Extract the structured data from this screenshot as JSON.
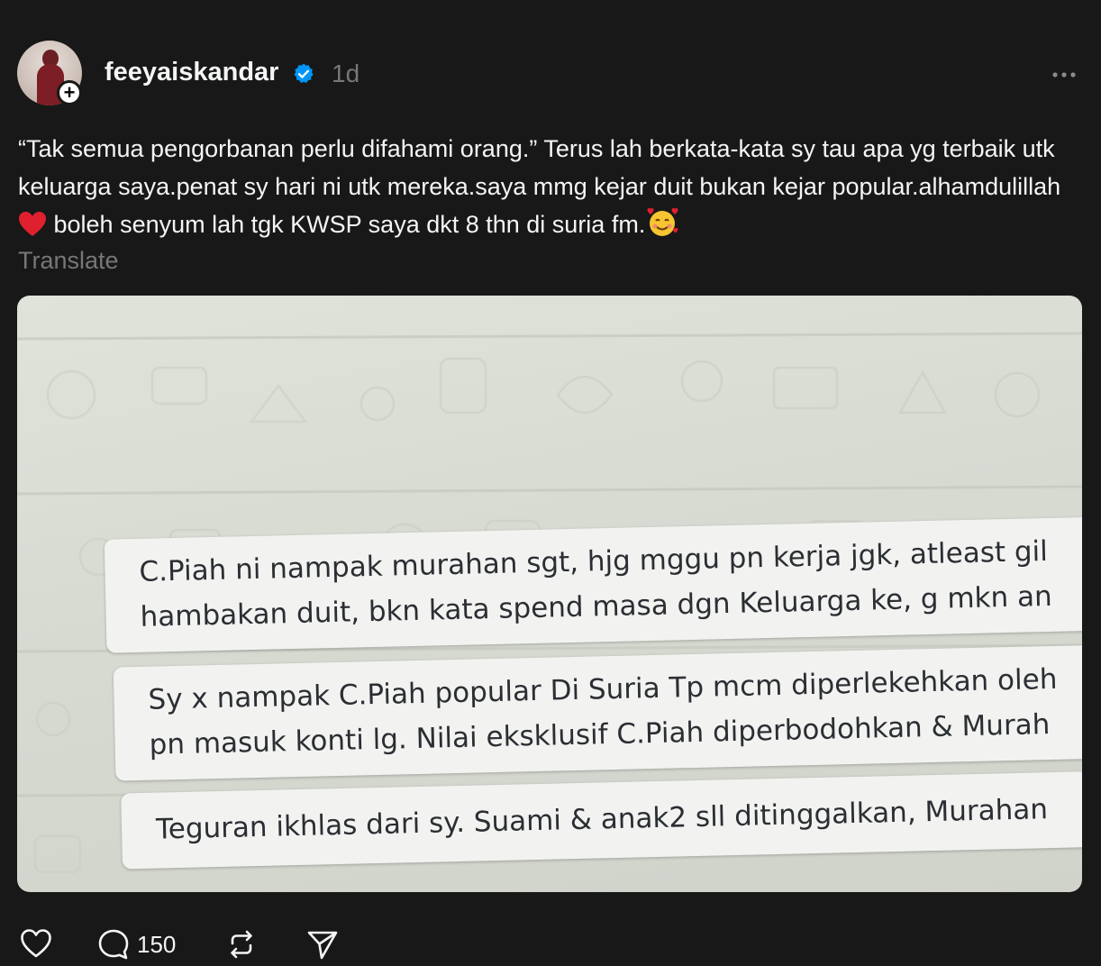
{
  "post": {
    "username": "feeyaiskandar",
    "verified": true,
    "time": "1d",
    "caption_text": "“Tak semua pengorbanan perlu difahami orang.” Terus lah berkata-kata sy tau apa yg terbaik utk keluarga saya.penat sy hari ni utk mereka.saya mmg kejar duit bukan kejar popular.alhamdulillah",
    "caption_tail": " boleh senyum lah tgk KWSP saya dkt 8 thn di suria fm.",
    "translate_label": "Translate"
  },
  "media": {
    "bubbles": [
      {
        "line1": "C.Piah ni nampak murahan sgt, hjg mggu pn kerja jgk, atleast gil",
        "line2": "hambakan duit, bkn kata spend masa dgn Keluarga ke, g mkn an"
      },
      {
        "line1": "Sy x nampak C.Piah popular Di Suria Tp mcm diperlekehkan oleh",
        "line2": "pn masuk konti lg. Nilai eksklusif C.Piah diperbodohkan & Murah"
      },
      {
        "line1": "Teguran ikhlas dari sy. Suami & anak2 sll ditinggalkan, Murahan"
      }
    ]
  },
  "actions": {
    "comment_count": "150"
  },
  "icons": {
    "verified": "verified-badge-icon",
    "more": "more-horizontal-icon",
    "like": "heart-icon",
    "comment": "comment-bubble-icon",
    "repost": "repost-icon",
    "share": "send-icon",
    "follow": "plus-icon"
  },
  "colors": {
    "background": "#181818",
    "text": "#f3f5f7",
    "muted": "#777777",
    "verified": "#0095f6",
    "heart": "#e0202e"
  }
}
